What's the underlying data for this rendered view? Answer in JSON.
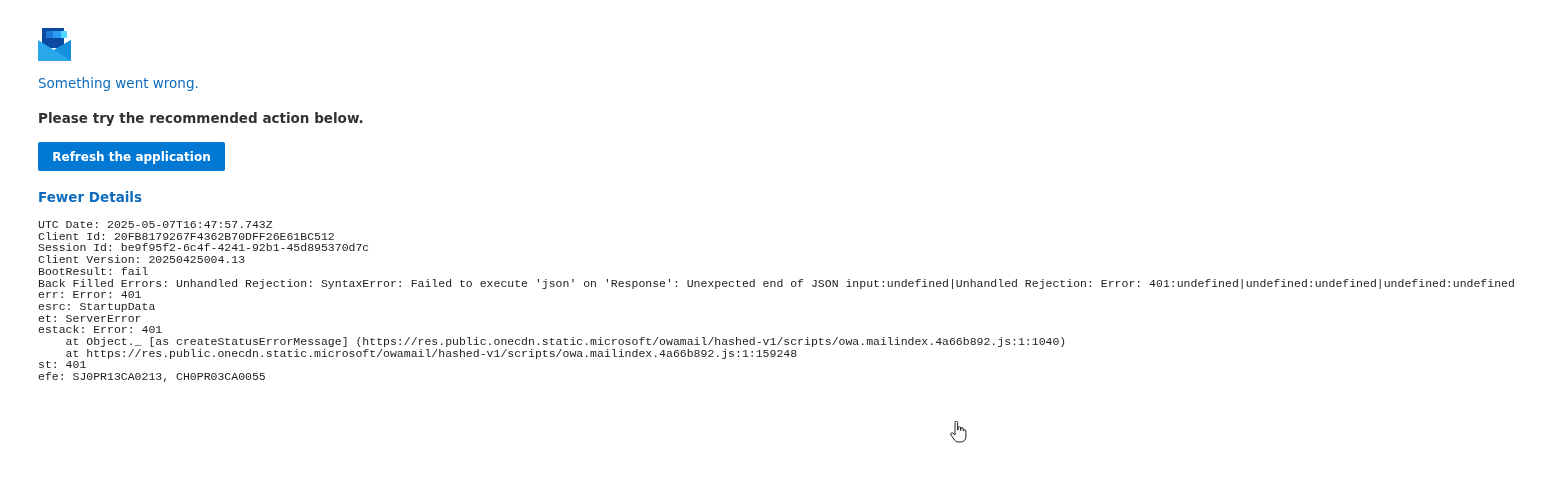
{
  "message": "Something went wrong.",
  "instruction": "Please try the recommended action below.",
  "action_button": "Refresh the application",
  "details_toggle": {
    "label": "Fewer Details",
    "expanded": true
  },
  "details": [
    "UTC Date: 2025-05-07T16:47:57.743Z",
    "Client Id: 20FB8179267F4362B70DFF26E61BC512",
    "Session Id: be9f95f2-6c4f-4241-92b1-45d895370d7c",
    "Client Version: 20250425004.13",
    "BootResult: fail",
    "Back Filled Errors: Unhandled Rejection: SyntaxError: Failed to execute 'json' on 'Response': Unexpected end of JSON input:undefined|Unhandled Rejection: Error: 401:undefined|undefined:undefined|undefined:undefined",
    "err: Error: 401",
    "esrc: StartupData",
    "et: ServerError",
    "estack: Error: 401",
    "    at Object._ [as createStatusErrorMessage] (https://res.public.onecdn.static.microsoft/owamail/hashed-v1/scripts/owa.mailindex.4a66b892.js:1:1040)",
    "    at https://res.public.onecdn.static.microsoft/owamail/hashed-v1/scripts/owa.mailindex.4a66b892.js:1:159248",
    "st: 401",
    "efe: SJ0PR13CA0213, CH0PR03CA0055"
  ]
}
